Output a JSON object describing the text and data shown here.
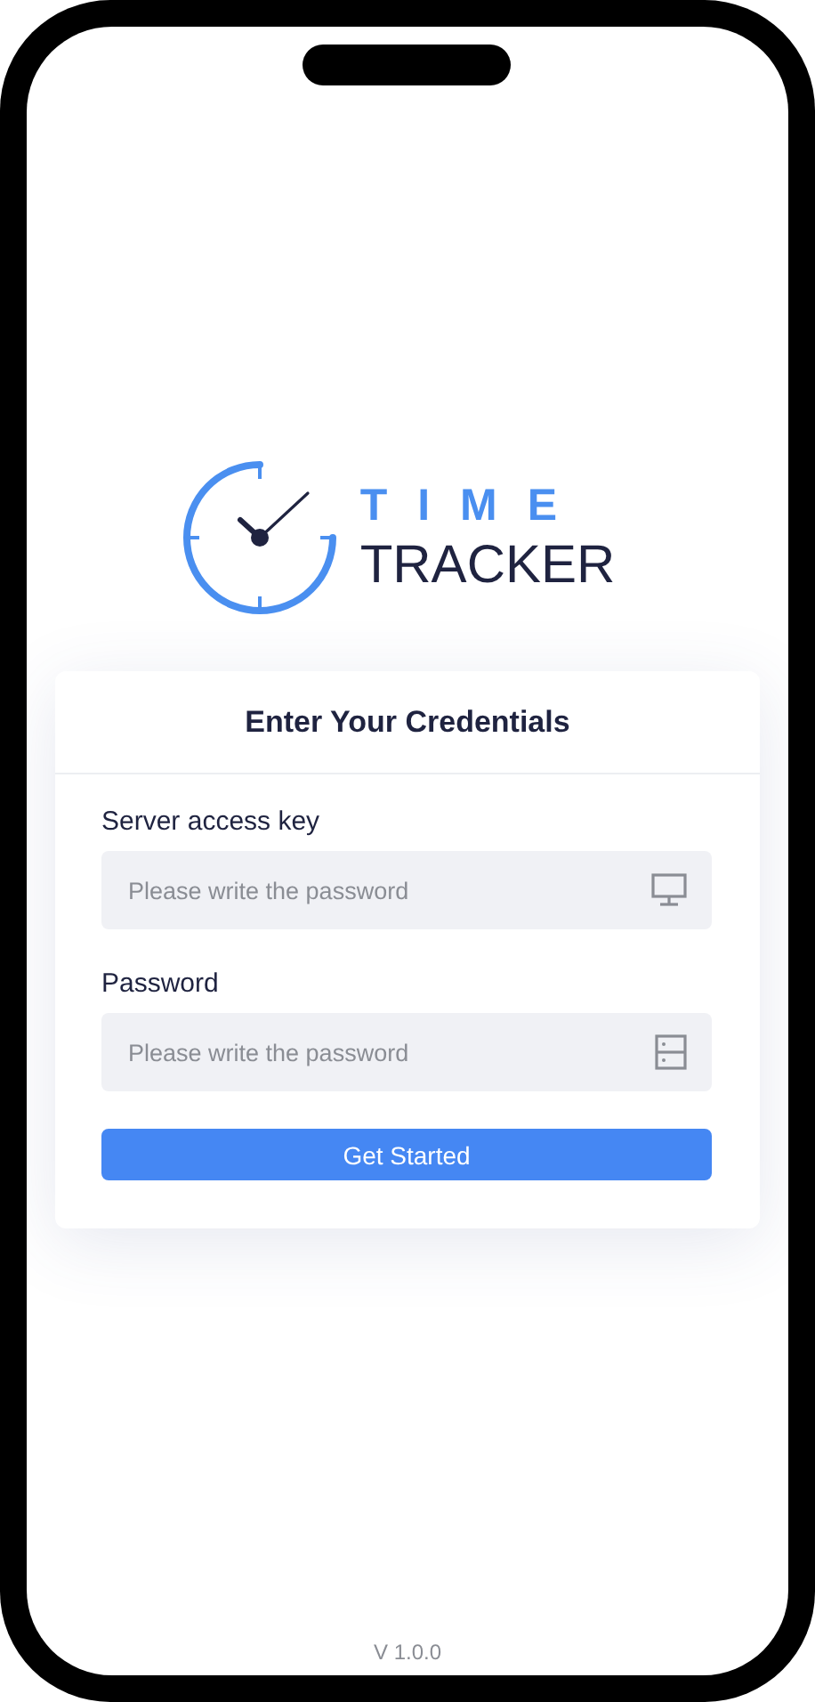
{
  "logo": {
    "line1": "TIME",
    "line2": "TRACKER"
  },
  "card": {
    "title": "Enter Your Credentials",
    "fields": [
      {
        "label": "Server access key",
        "placeholder": "Please write the password",
        "kind": "monitor"
      },
      {
        "label": "Password",
        "placeholder": "Please write the password",
        "kind": "server"
      }
    ],
    "button": "Get Started"
  },
  "version": "V 1.0.0"
}
